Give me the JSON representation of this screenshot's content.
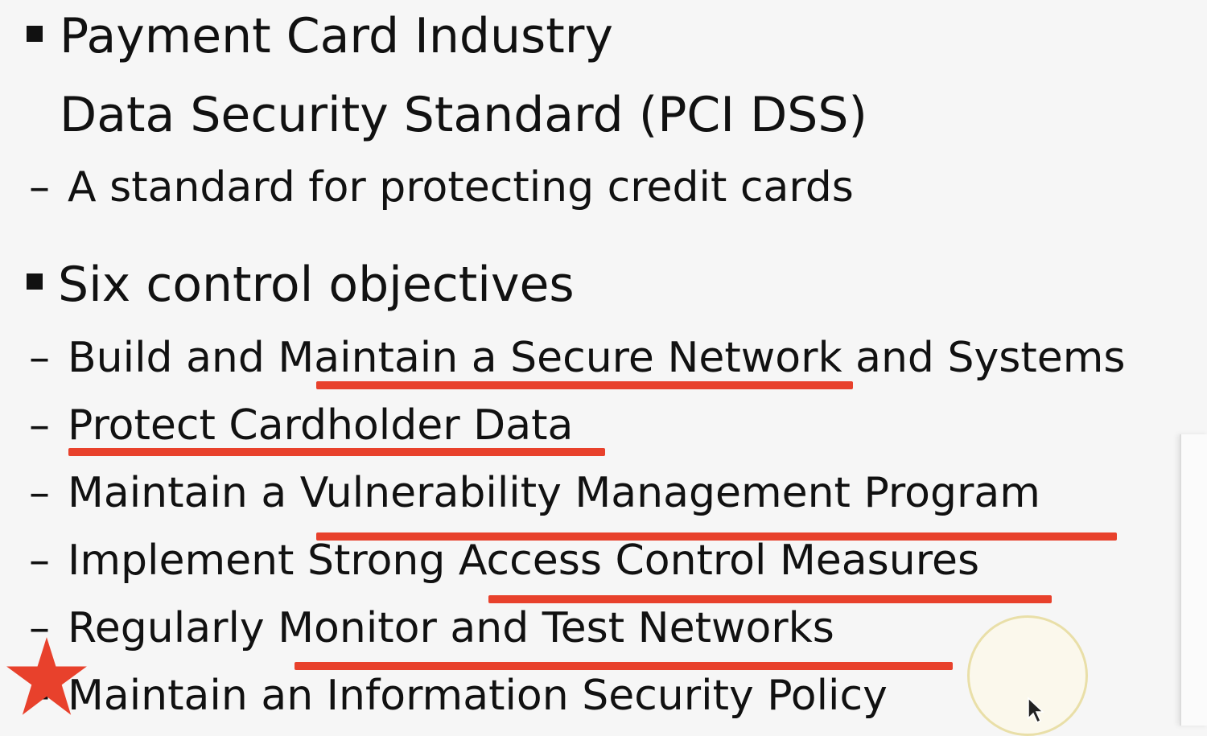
{
  "slide": {
    "bullet1_line1": "Payment Card Industry",
    "bullet1_line2": "Data Security Standard (PCI DSS)",
    "bullet1_sub": "A standard for protecting credit cards",
    "bullet2": "Six control objectives",
    "dash": "–",
    "objectives": [
      "Build and Maintain a Secure Network and Systems",
      "Protect Cardholder Data",
      "Maintain a Vulnerability Management Program",
      "Implement Strong Access Control Measures",
      "Regularly Monitor and Test Networks",
      "Maintain an Information Security Policy"
    ]
  },
  "colors": {
    "annotation": "#e8412c",
    "text": "#111111",
    "background": "#f6f6f6"
  },
  "icons": {
    "star": "star-icon",
    "cursor": "mouse-pointer-icon"
  }
}
